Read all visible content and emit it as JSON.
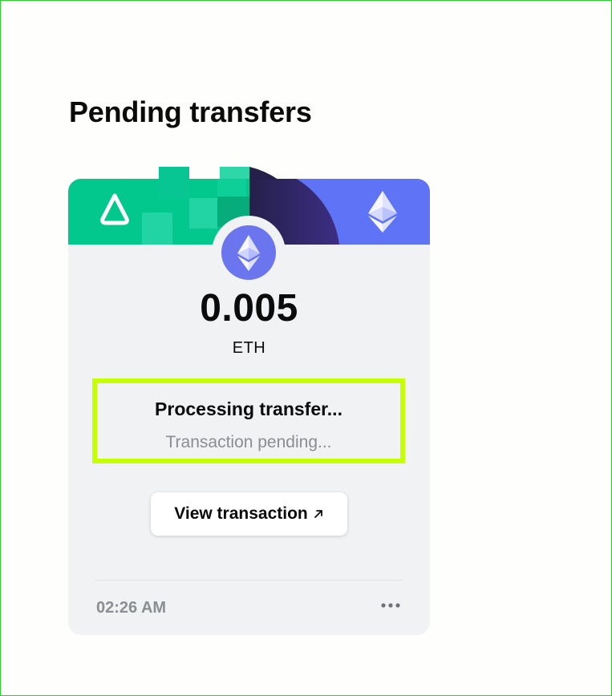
{
  "page": {
    "title": "Pending transfers"
  },
  "transfer": {
    "amount": "0.005",
    "unit": "ETH",
    "source_chain_icon": "arbitrum-style-a-icon",
    "destination_chain_icon": "ethereum-icon",
    "token_icon": "ethereum-icon",
    "status_title": "Processing transfer...",
    "status_subtitle": "Transaction pending...",
    "view_button_label": "View transaction",
    "view_button_icon": "arrow-up-right-icon",
    "time": "02:26 AM",
    "more_icon": "more-horizontal-icon"
  },
  "colors": {
    "accent_green": "#02c88d",
    "accent_purple": "#5f73f6",
    "highlight": "#c6ff04",
    "card_bg": "#f1f2f3",
    "muted_text": "#8a8d92"
  }
}
